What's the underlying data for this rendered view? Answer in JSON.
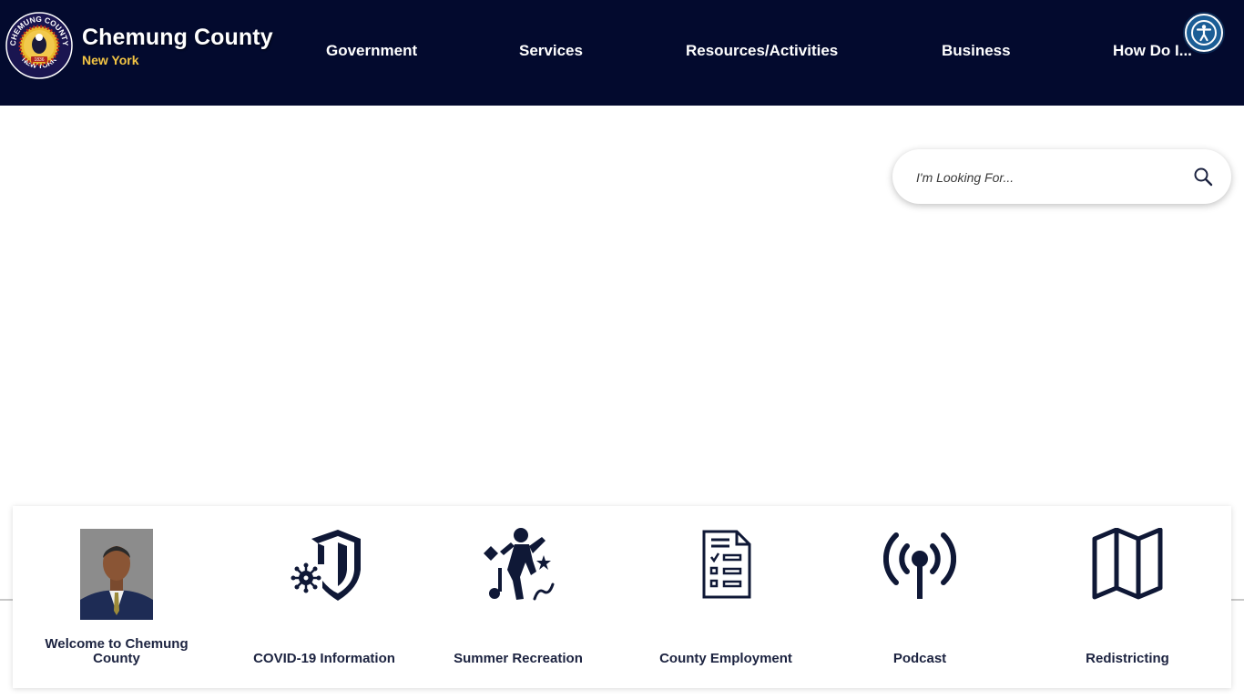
{
  "header": {
    "site_title": "Chemung County",
    "site_subtitle": "New York",
    "seal_text_top": "CHEMUNG COUNTY",
    "seal_text_bottom": "NEW YORK",
    "seal_year": "1836",
    "brand_color": "#030a2e",
    "accent_color": "#f3c544"
  },
  "nav": {
    "items": [
      {
        "label": "Government"
      },
      {
        "label": "Services"
      },
      {
        "label": "Resources/Activities"
      },
      {
        "label": "Business"
      },
      {
        "label": "How Do I..."
      }
    ]
  },
  "accessibility": {
    "icon": "accessibility-icon"
  },
  "search": {
    "placeholder": "I'm Looking For...",
    "value": "",
    "icon": "search-icon"
  },
  "quick_links": [
    {
      "label": "Welcome to Chemung County",
      "icon": "portrait-photo"
    },
    {
      "label": "COVID-19 Information",
      "icon": "virus-shield-icon"
    },
    {
      "label": "Summer Recreation",
      "icon": "dancing-person-icon"
    },
    {
      "label": "County Employment",
      "icon": "checklist-icon"
    },
    {
      "label": "Podcast",
      "icon": "broadcast-icon"
    },
    {
      "label": "Redistricting",
      "icon": "map-icon"
    }
  ]
}
